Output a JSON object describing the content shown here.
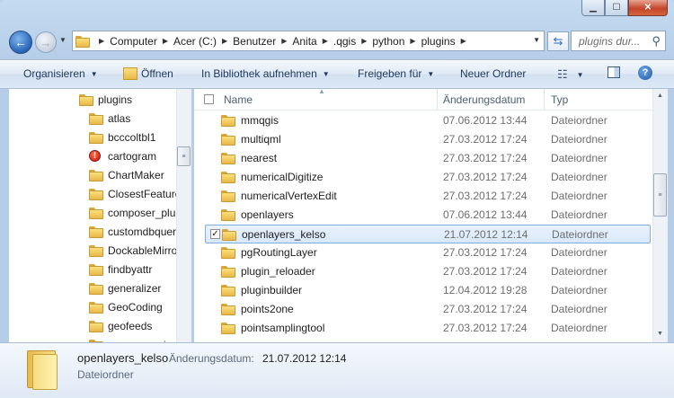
{
  "address": {
    "crumbs": [
      "Computer",
      "Acer (C:)",
      "Benutzer",
      "Anita",
      ".qgis",
      "python",
      "plugins"
    ],
    "search_placeholder": "plugins dur..."
  },
  "toolbar": {
    "organize": "Organisieren",
    "open": "Öffnen",
    "library": "In Bibliothek aufnehmen",
    "share": "Freigeben für",
    "new_folder": "Neuer Ordner"
  },
  "navpane": {
    "root": "plugins",
    "items": [
      {
        "label": "atlas",
        "icon": "folder"
      },
      {
        "label": "bcccoltbl1",
        "icon": "folder"
      },
      {
        "label": "cartogram",
        "icon": "warning"
      },
      {
        "label": "ChartMaker",
        "icon": "folder"
      },
      {
        "label": "ClosestFeature",
        "icon": "folder"
      },
      {
        "label": "composer_plu",
        "icon": "folder"
      },
      {
        "label": "customdbquer",
        "icon": "folder"
      },
      {
        "label": "DockableMirro",
        "icon": "folder"
      },
      {
        "label": "findbyattr",
        "icon": "folder"
      },
      {
        "label": "generalizer",
        "icon": "folder"
      },
      {
        "label": "GeoCoding",
        "icon": "folder"
      },
      {
        "label": "geofeeds",
        "icon": "folder"
      },
      {
        "label": "geoprocessing",
        "icon": "folder"
      }
    ]
  },
  "columns": {
    "name": "Name",
    "date": "Änderungsdatum",
    "type": "Typ"
  },
  "files": [
    {
      "name": "mmqgis",
      "date": "07.06.2012 13:44",
      "type": "Dateiordner"
    },
    {
      "name": "multiqml",
      "date": "27.03.2012 17:24",
      "type": "Dateiordner"
    },
    {
      "name": "nearest",
      "date": "27.03.2012 17:24",
      "type": "Dateiordner"
    },
    {
      "name": "numericalDigitize",
      "date": "27.03.2012 17:24",
      "type": "Dateiordner"
    },
    {
      "name": "numericalVertexEdit",
      "date": "27.03.2012 17:24",
      "type": "Dateiordner"
    },
    {
      "name": "openlayers",
      "date": "07.06.2012 13:44",
      "type": "Dateiordner"
    },
    {
      "name": "openlayers_kelso",
      "date": "21.07.2012 12:14",
      "type": "Dateiordner",
      "selected": true
    },
    {
      "name": "pgRoutingLayer",
      "date": "27.03.2012 17:24",
      "type": "Dateiordner"
    },
    {
      "name": "plugin_reloader",
      "date": "27.03.2012 17:24",
      "type": "Dateiordner"
    },
    {
      "name": "pluginbuilder",
      "date": "12.04.2012 19:28",
      "type": "Dateiordner"
    },
    {
      "name": "points2one",
      "date": "27.03.2012 17:24",
      "type": "Dateiordner"
    },
    {
      "name": "pointsamplingtool",
      "date": "27.03.2012 17:24",
      "type": "Dateiordner"
    }
  ],
  "details": {
    "name": "openlayers_kelso",
    "date_label": "Änderungsdatum:",
    "date_value": "21.07.2012 12:14",
    "type": "Dateiordner"
  }
}
